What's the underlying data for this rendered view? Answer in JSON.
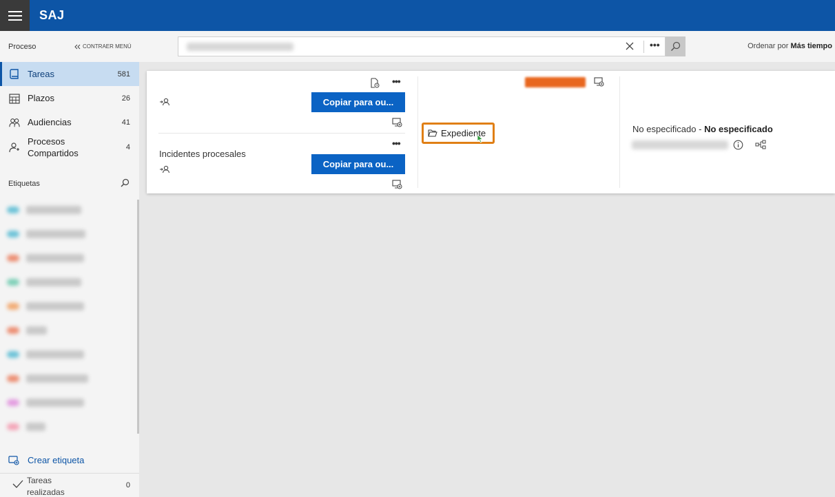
{
  "header": {
    "app_title": "SAJ"
  },
  "sidebar": {
    "section_title": "Proceso",
    "collapse_label": "CONTRAER MENÚ",
    "items": [
      {
        "label": "Tareas",
        "count": "581",
        "icon": "book-icon",
        "active": true
      },
      {
        "label": "Plazos",
        "count": "26",
        "icon": "calendar-icon",
        "active": false
      },
      {
        "label": "Audiencias",
        "count": "41",
        "icon": "people-icon",
        "active": false
      },
      {
        "label": "Procesos\nCompartidos",
        "count": "4",
        "icon": "shared-person-icon",
        "active": false
      }
    ],
    "tags_title": "Etiquetas",
    "tag_colors": [
      "#6ec3d8",
      "#6ec3d8",
      "#ec8f74",
      "#7fd0b8",
      "#f2ac75",
      "#ec8f74",
      "#6ec3d8",
      "#ec8f74",
      "#e39ce0",
      "#f4a6b8"
    ],
    "create_tag_label": "Crear etiqueta",
    "completed_label": "Tareas\nrealizadas",
    "completed_count": "0"
  },
  "toolbar": {
    "sort_label": "Ordenar por",
    "sort_value": "Más tiempo"
  },
  "card": {
    "rows": [
      {
        "title": "",
        "button_label": "Copiar para ou..."
      },
      {
        "title": "Incidentes procesales",
        "button_label": "Copiar para ou..."
      }
    ],
    "expediente_label": "Expediente",
    "status": "No especificado - ",
    "status_bold": "No especificado"
  },
  "colors": {
    "brand_blue": "#0d55a6",
    "button_blue": "#0b63c4",
    "highlight_orange": "#e07f15"
  }
}
